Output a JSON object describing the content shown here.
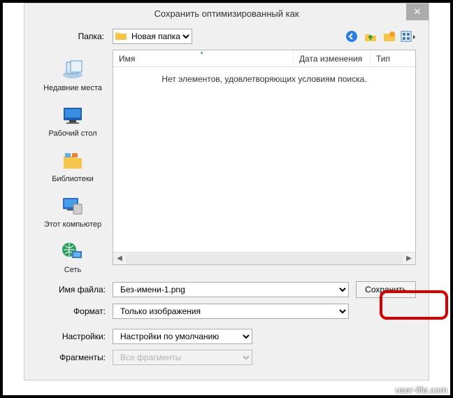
{
  "title": "Сохранить оптимизированный как",
  "folder": {
    "label": "Папка:",
    "value": "Новая папка"
  },
  "columns": {
    "name": "Имя",
    "date": "Дата изменения",
    "type": "Тип"
  },
  "empty": "Нет элементов, удовлетворяющих условиям поиска.",
  "sidebar": [
    {
      "label": "Недавние места"
    },
    {
      "label": "Рабочий стол"
    },
    {
      "label": "Библиотеки"
    },
    {
      "label": "Этот компьютер"
    },
    {
      "label": "Сеть"
    }
  ],
  "fields": {
    "filename": {
      "label": "Имя файла:",
      "value": "Без-имени-1.png"
    },
    "format": {
      "label": "Формат:",
      "value": "Только изображения"
    },
    "settings": {
      "label": "Настройки:",
      "value": "Настройки по умолчанию"
    },
    "fragments": {
      "label": "Фрагменты:",
      "value": "Все фрагменты"
    }
  },
  "buttons": {
    "save": "Сохранить"
  },
  "watermark": "user-life.com"
}
